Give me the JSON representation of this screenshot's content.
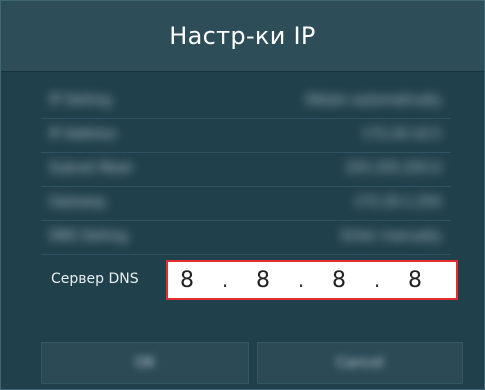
{
  "dialog": {
    "title": "Настр-ки IP"
  },
  "settings": [
    {
      "label": "IP Setting",
      "value": "Obtain automatically"
    },
    {
      "label": "IP Address",
      "value": "172.20.10.5"
    },
    {
      "label": "Subnet Mask",
      "value": "255.255.255.0"
    },
    {
      "label": "Gateway",
      "value": "172.20.1.254"
    },
    {
      "label": "DNS Setting",
      "value": "Enter manually"
    }
  ],
  "dns": {
    "label": "Сервер DNS",
    "octets": [
      "8",
      "8",
      "8",
      "8"
    ],
    "separator": "."
  },
  "buttons": {
    "ok": "OK",
    "cancel": "Cancel"
  },
  "colors": {
    "background": "#20404b",
    "header": "#2d4d59",
    "focus_border": "#e02d2d",
    "field_bg": "#ffffff"
  }
}
